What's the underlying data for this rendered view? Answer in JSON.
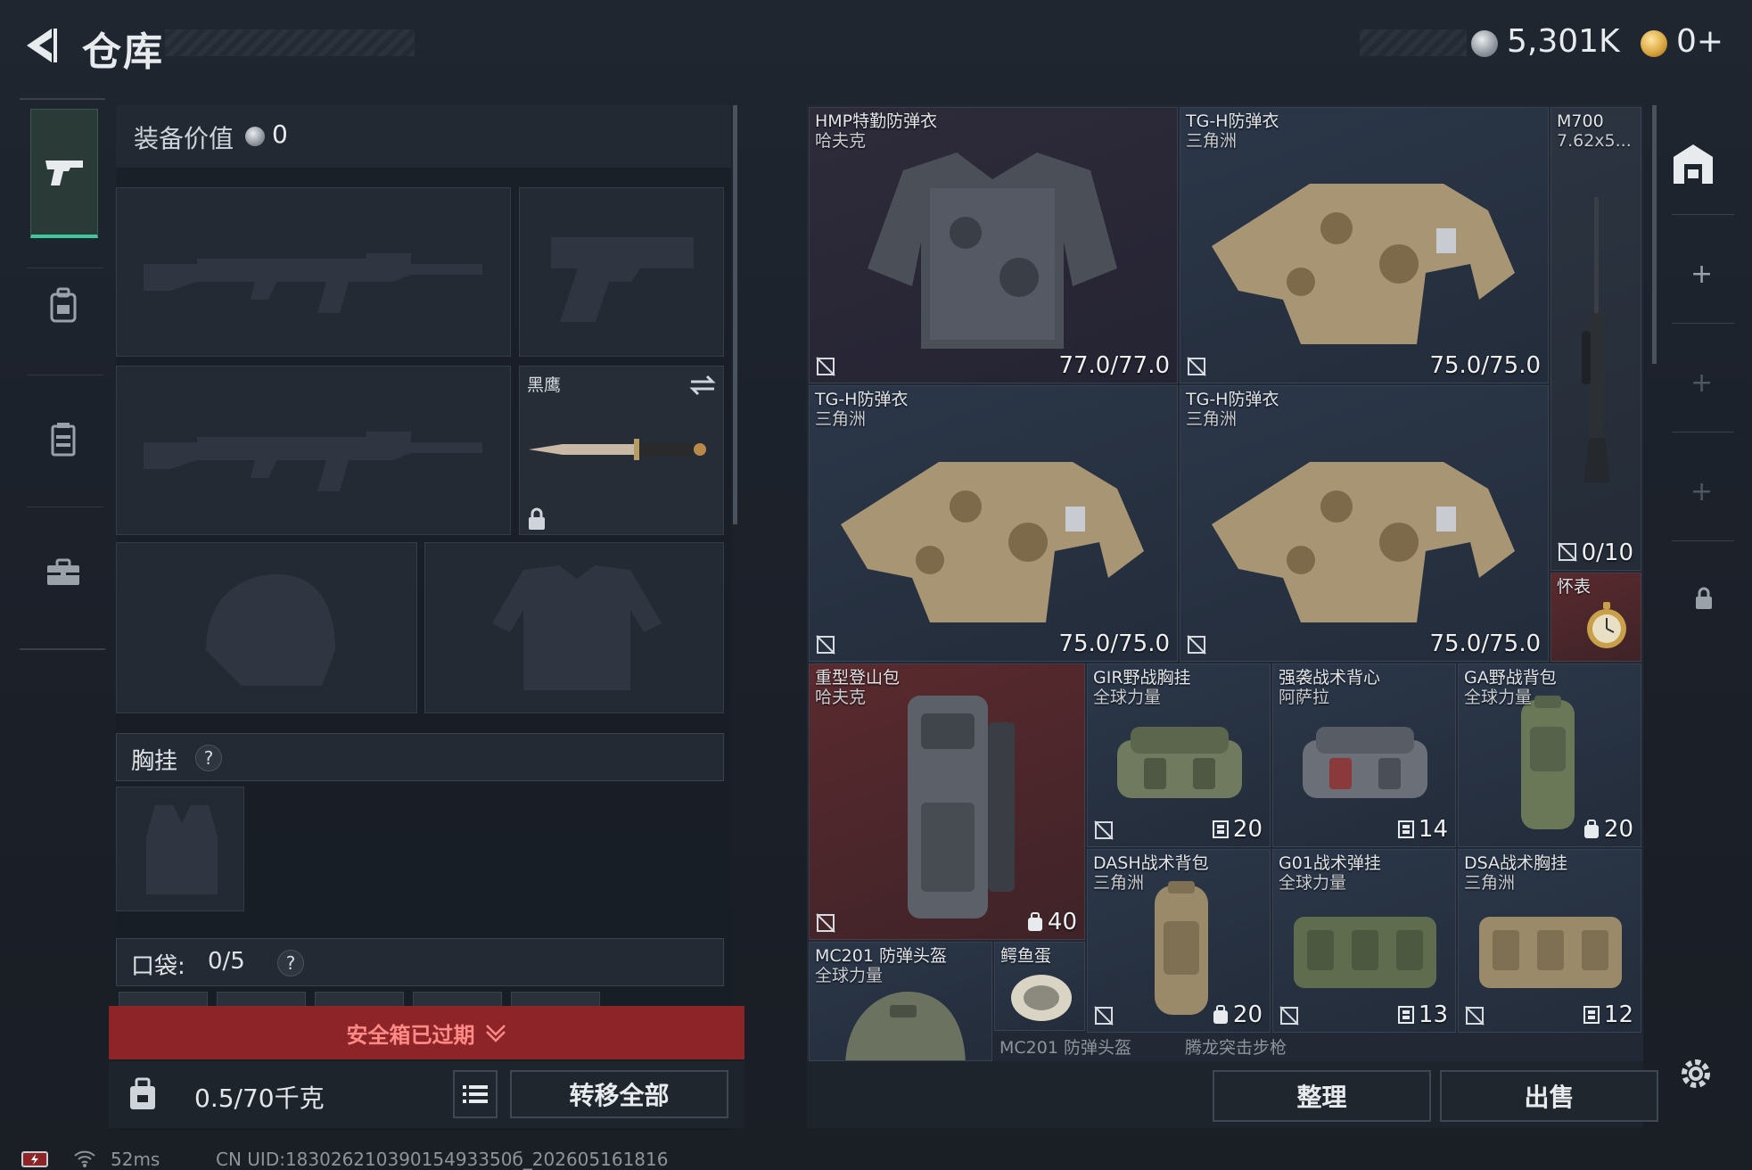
{
  "header": {
    "title": "仓库",
    "currency_main": "5,301K",
    "currency_secondary": "0+"
  },
  "equipment": {
    "value_label": "装备价值",
    "value": "0",
    "melee_name": "黑鹰",
    "chest_rig_label": "胸挂",
    "pocket_label": "口袋:",
    "pocket_count": "0/5",
    "safebox_expired": "安全箱已过期",
    "weight": "0.5/70千克",
    "transfer_all": "转移全部"
  },
  "inventory": {
    "items": [
      {
        "name": "HMP特勤防弹衣",
        "sub": "哈夫克",
        "durability": "77.0/77.0"
      },
      {
        "name": "TG-H防弹衣",
        "sub": "三角洲",
        "durability": "75.0/75.0"
      },
      {
        "name": "M700",
        "sub": "7.62x5...",
        "durability": "0/10"
      },
      {
        "name": "TG-H防弹衣",
        "sub": "三角洲",
        "durability": "75.0/75.0"
      },
      {
        "name": "TG-H防弹衣",
        "sub": "三角洲",
        "durability": "75.0/75.0"
      },
      {
        "name": "怀表",
        "sub": "",
        "durability": ""
      },
      {
        "name": "重型登山包",
        "sub": "哈夫克",
        "capacity": "40"
      },
      {
        "name": "GIR野战胸挂",
        "sub": "全球力量",
        "capacity": "20"
      },
      {
        "name": "强袭战术背心",
        "sub": "阿萨拉",
        "capacity": "14"
      },
      {
        "name": "GA野战背包",
        "sub": "全球力量",
        "capacity": "20"
      },
      {
        "name": "DASH战术背包",
        "sub": "三角洲",
        "capacity": "20"
      },
      {
        "name": "G01战术弹挂",
        "sub": "全球力量",
        "capacity": "13"
      },
      {
        "name": "DSA战术胸挂",
        "sub": "三角洲",
        "capacity": "12"
      },
      {
        "name": "MC201 防弹头盔",
        "sub": "全球力量",
        "capacity": ""
      },
      {
        "name": "鳄鱼蛋",
        "sub": "",
        "capacity": ""
      }
    ],
    "next_row": [
      "MC201 防弹头盔",
      "腾龙突击步枪"
    ],
    "sort_label": "整理",
    "sell_label": "出售"
  },
  "status": {
    "ping": "52ms",
    "uid": "CN UID:18302621039015493350б_202605161816"
  },
  "colors": {
    "accent_green": "#3fc89a",
    "expired_red": "#8d2428",
    "rarity_red": "#5a2a2e",
    "rarity_blue": "#2b3749"
  }
}
